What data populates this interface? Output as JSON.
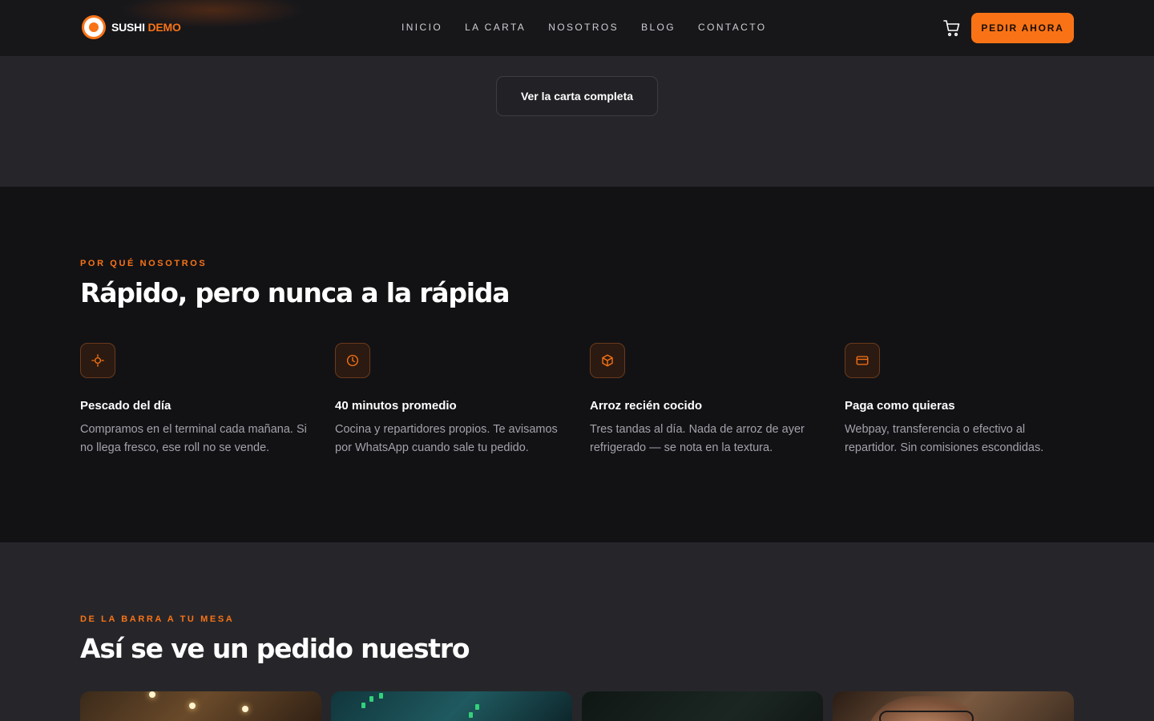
{
  "header": {
    "logo": {
      "part1": "SUSHI",
      "part2": "DEMO"
    },
    "nav": [
      "INICIO",
      "LA CARTA",
      "NOSOTROS",
      "BLOG",
      "CONTACTO"
    ],
    "cta_label": "PEDIR AHORA"
  },
  "menu_section": {
    "button_label": "Ver la carta completa"
  },
  "why_section": {
    "eyebrow": "POR QUÉ NOSOTROS",
    "title": "Rápido, pero nunca a la rápida",
    "features": [
      {
        "icon": "sun-icon",
        "title": "Pescado del día",
        "desc": "Compramos en el terminal cada mañana. Si no llega fresco, ese roll no se vende."
      },
      {
        "icon": "clock-icon",
        "title": "40 minutos promedio",
        "desc": "Cocina y repartidores propios. Te avisamos por WhatsApp cuando sale tu pedido."
      },
      {
        "icon": "box-icon",
        "title": "Arroz recién cocido",
        "desc": "Tres tandas al día. Nada de arroz de ayer refrigerado — se nota en la textura."
      },
      {
        "icon": "credit-card-icon",
        "title": "Paga como quieras",
        "desc": "Webpay, transferencia o efectivo al repartidor. Sin comisiones escondidas."
      }
    ]
  },
  "gallery_section": {
    "eyebrow": "DE LA BARRA A TU MESA",
    "title": "Así se ve un pedido nuestro"
  },
  "colors": {
    "accent": "#f97316",
    "bg_dark": "#121215",
    "bg_section": "#26262a"
  }
}
